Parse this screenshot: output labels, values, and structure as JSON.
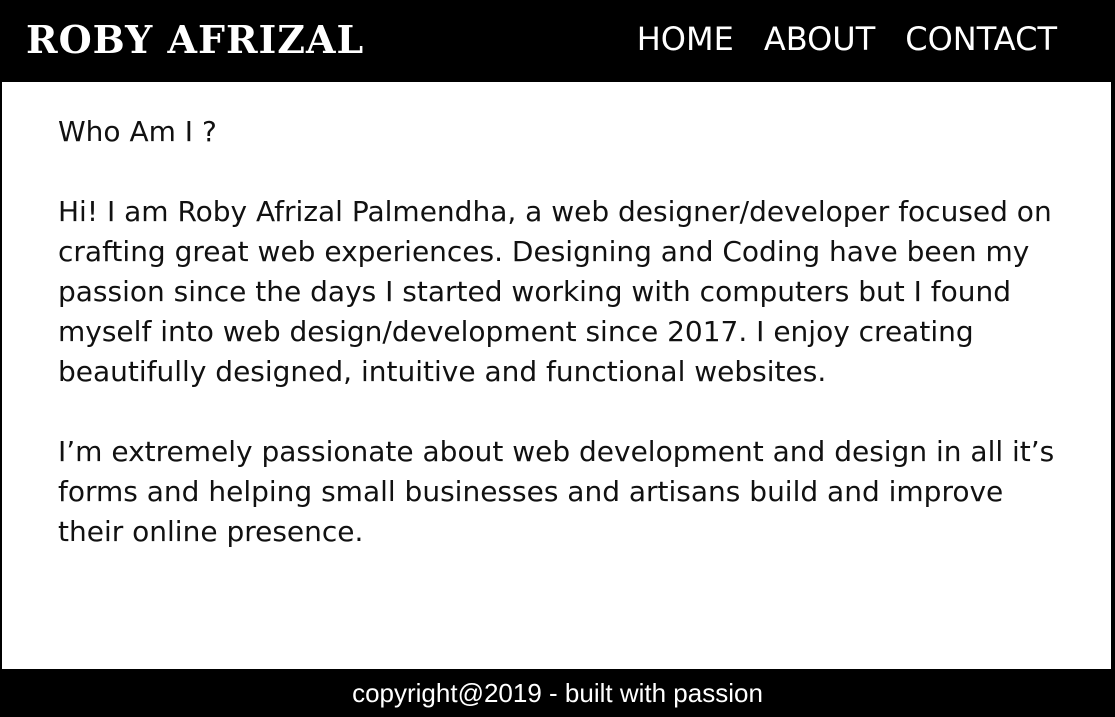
{
  "header": {
    "logo": "ROBY AFRIZAL",
    "nav": [
      {
        "label": "HOME"
      },
      {
        "label": "ABOUT"
      },
      {
        "label": "CONTACT"
      }
    ]
  },
  "main": {
    "heading": "Who Am I ?",
    "paragraphs": [
      "Hi! I am Roby Afrizal Palmendha, a web designer/developer focused on crafting great web experiences. Designing and Coding have been my passion since the days I started working with computers but I found myself into web design/development since 2017. I enjoy creating beautifully designed, intuitive and functional websites.",
      "I’m extremely passionate about web development and design in all it’s forms and helping small businesses and artisans build and improve their online presence."
    ]
  },
  "footer": {
    "copyright": "copyright@2019 - built with passion"
  },
  "colors": {
    "header_bg": "#000000",
    "content_bg": "#ffffff",
    "text": "#111111"
  }
}
